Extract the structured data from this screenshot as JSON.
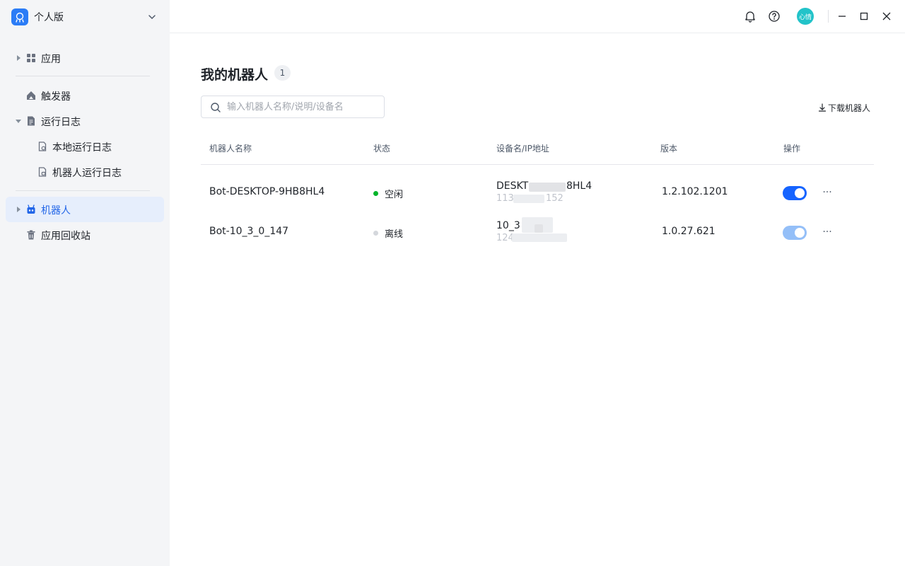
{
  "sidebar": {
    "workspace": "个人版",
    "items": [
      {
        "id": "apps",
        "label": "应用"
      },
      {
        "id": "triggers",
        "label": "触发器"
      },
      {
        "id": "logs",
        "label": "运行日志"
      },
      {
        "id": "local-logs",
        "label": "本地运行日志"
      },
      {
        "id": "robot-logs",
        "label": "机器人运行日志"
      },
      {
        "id": "robots",
        "label": "机器人"
      },
      {
        "id": "recycle",
        "label": "应用回收站"
      }
    ]
  },
  "topbar": {
    "avatar_text": "心情"
  },
  "main": {
    "title": "我的机器人",
    "count": "1",
    "search_placeholder": "输入机器人名称/说明/设备名",
    "download_label": "下载机器人",
    "columns": [
      "机器人名称",
      "状态",
      "设备名/IP地址",
      "版本",
      "操作"
    ],
    "rows": [
      {
        "name": "Bot-DESKTOP-9HB8HL4",
        "status": "空闲",
        "status_color": "#00b42a",
        "device_prefix": "DESKT",
        "device_suffix": "8HL4",
        "ip_prefix": "113",
        "ip_suffix": "152",
        "version": "1.2.102.1201",
        "enabled_color": "#1664ff",
        "more": "···"
      },
      {
        "name": "Bot-10_3_0_147",
        "status": "离线",
        "status_color": "#c9cdd4",
        "device_prefix": "10_3",
        "device_suffix": "",
        "ip_prefix": "124",
        "ip_suffix": "",
        "version": "1.0.27.621",
        "enabled_color": "#94bff8",
        "more": "···"
      }
    ]
  }
}
